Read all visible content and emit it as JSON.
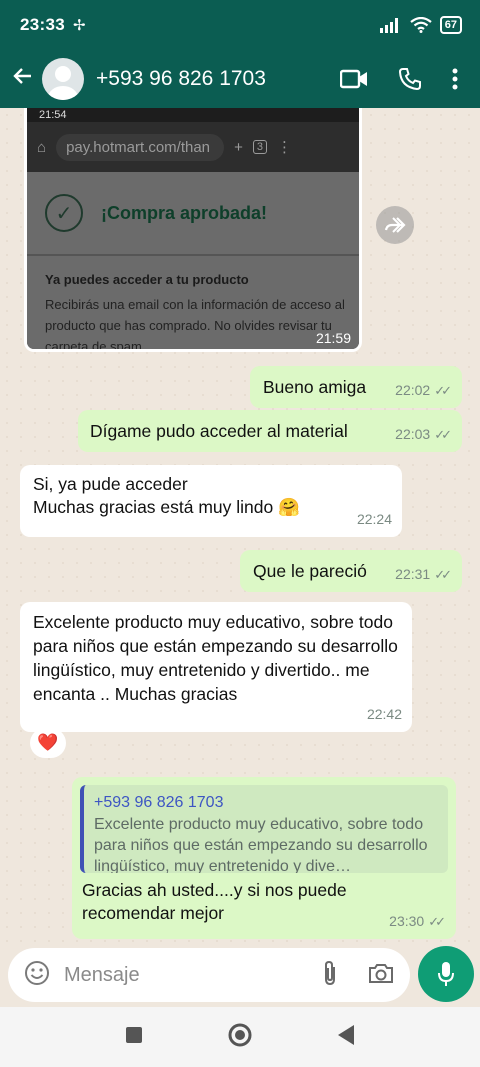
{
  "status_bar": {
    "time": "23:33",
    "battery": "67"
  },
  "app_bar": {
    "contact": "+593 96 826 1703"
  },
  "image_message": {
    "screenshot_time": "21:54",
    "url": "pay.hotmart.com/than",
    "tab_count": "3",
    "approved_text": "¡Compra aprobada!",
    "access_title": "Ya puedes acceder a tu producto",
    "access_body": "Recibirás una email con la información de acceso al producto que has comprado. No olvides revisar tu carpeta de spam",
    "time": "21:59"
  },
  "messages": [
    {
      "id": "m1",
      "side": "out",
      "text": "Bueno amiga",
      "time": "22:02"
    },
    {
      "id": "m2",
      "side": "out",
      "text": "Dígame pudo acceder al material",
      "time": "22:03"
    },
    {
      "id": "m3",
      "side": "in",
      "line1": "Si, ya pude acceder",
      "line2": "Muchas gracias está muy lindo",
      "emoji": "🤗",
      "time": "22:24"
    },
    {
      "id": "m4",
      "side": "out",
      "text": "Que le pareció",
      "time": "22:31"
    },
    {
      "id": "m5",
      "side": "in",
      "text": "Excelente producto muy educativo, sobre todo para niños que están empezando su desarrollo lingüístico, muy entretenido y divertido.. me encanta .. Muchas gracias",
      "time": "22:42",
      "reaction": "❤️"
    },
    {
      "id": "m6",
      "side": "out",
      "quote_name": "+593 96 826 1703",
      "quote_text": "Excelente producto muy educativo, sobre todo para niños que están empezando su desarrollo lingüístico, muy entretenido y dive…",
      "text": "Gracias ah usted....y si nos puede recomendar mejor",
      "time": "23:30"
    }
  ],
  "composer": {
    "placeholder": "Mensaje"
  },
  "colors": {
    "header": "#0b5d52",
    "outgoing": "#dcf8c6",
    "incoming": "#ffffff",
    "mic": "#0f9d75"
  }
}
